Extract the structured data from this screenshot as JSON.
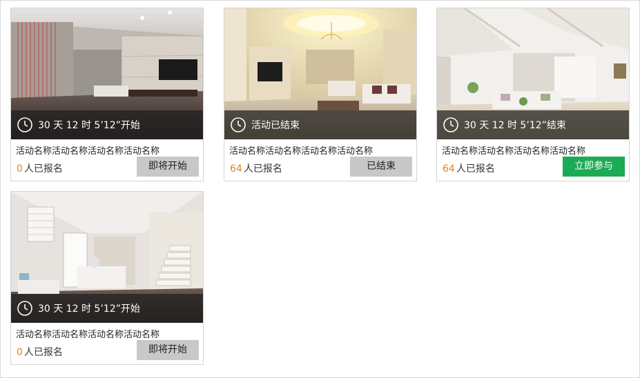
{
  "colors": {
    "accent_green": "#1aab54",
    "count_orange": "#e8811e",
    "button_gray": "#c8c8c8",
    "overlay": "#1e1e1e"
  },
  "cards": [
    {
      "time_text": "30 天 12 时 5’12”开始",
      "title": "活动名称活动名称活动名称活动名称",
      "count": "0",
      "count_suffix": "人已报名",
      "button_label": "即将开始",
      "button_state": "upcoming",
      "icon": "clock-icon"
    },
    {
      "time_text": "活动已结束",
      "title": "活动名称活动名称活动名称活动名称",
      "count": "64",
      "count_suffix": "人已报名",
      "button_label": "已结束",
      "button_state": "ended",
      "icon": "clock-icon"
    },
    {
      "time_text": "30 天 12 时 5’12”结束",
      "title": "活动名称活动名称活动名称活动名称",
      "count": "64",
      "count_suffix": "人已报名",
      "button_label": "立即参与",
      "button_state": "active",
      "icon": "clock-icon"
    },
    {
      "time_text": "30 天 12 时 5’12”开始",
      "title": "活动名称活动名称活动名称活动名称",
      "count": "0",
      "count_suffix": "人已报名",
      "button_label": "即将开始",
      "button_state": "upcoming",
      "icon": "clock-icon"
    }
  ]
}
